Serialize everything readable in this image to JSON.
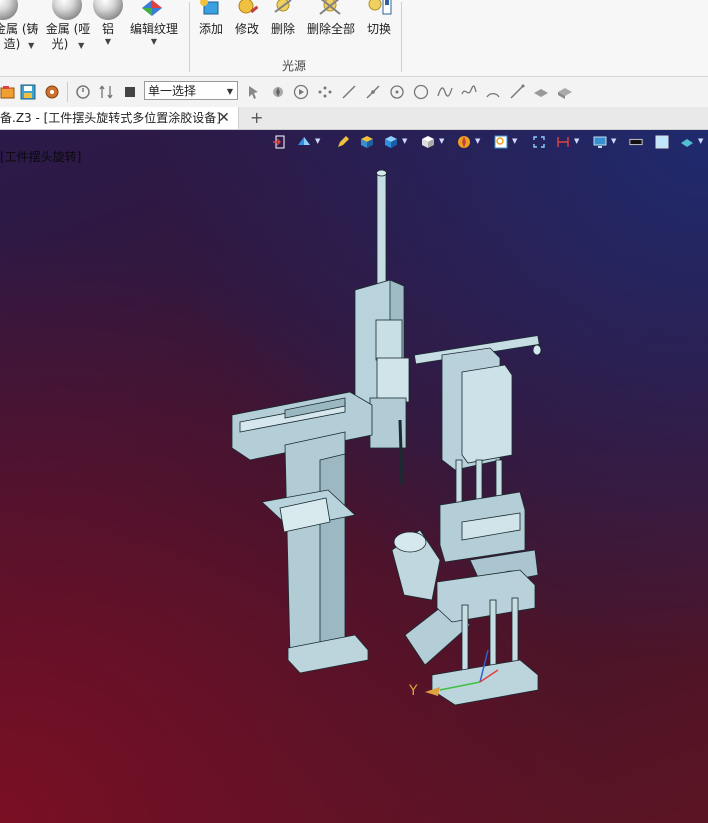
{
  "ribbon": {
    "materials": [
      {
        "label_line1": "金属 (铸",
        "label_line2": "造)",
        "icon": "metal-cast-sphere-icon"
      },
      {
        "label_line1": "金属 (哑",
        "label_line2": "光)",
        "icon": "metal-matte-sphere-icon"
      },
      {
        "label_line1": "铝",
        "label_line2": "",
        "icon": "aluminum-sphere-icon"
      },
      {
        "label_line1": "编辑纹理",
        "label_line2": "",
        "icon": "edit-texture-icon"
      }
    ],
    "light_buttons": [
      {
        "label": "添加",
        "icon": "add-light-icon"
      },
      {
        "label": "修改",
        "icon": "modify-light-icon"
      },
      {
        "label": "删除",
        "icon": "delete-light-icon"
      },
      {
        "label": "删除全部",
        "icon": "delete-all-lights-icon"
      },
      {
        "label": "切换",
        "icon": "switch-light-icon"
      }
    ],
    "group_label": "光源"
  },
  "toolbar": {
    "selection_mode": "单一选择"
  },
  "tab": {
    "title": "备.Z3 - [工件摆头旋转式多位置涂胶设备]",
    "close": "✕",
    "add": "+"
  },
  "viewport": {
    "overlay_text": "[工件摆头旋转]",
    "axis_label": "Y"
  }
}
